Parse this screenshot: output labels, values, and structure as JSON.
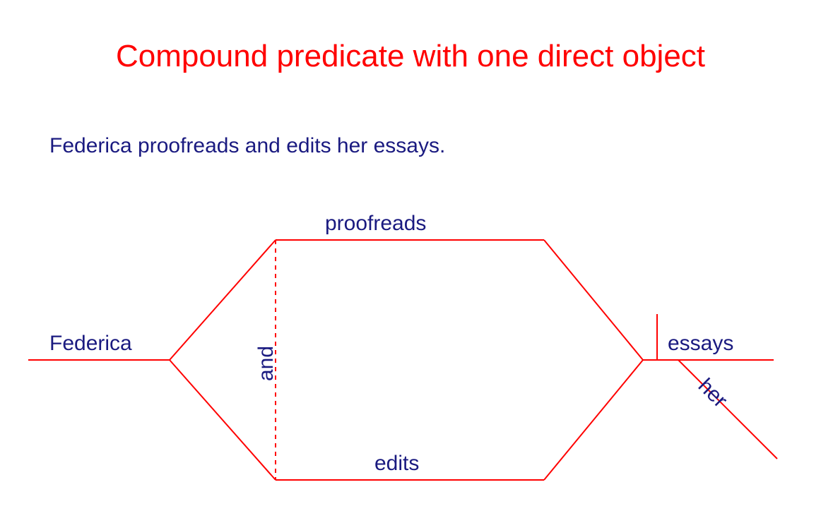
{
  "title": "Compound predicate with one direct object",
  "sentence": "Federica proofreads and edits her essays.",
  "labels": {
    "subject": "Federica",
    "verb1": "proofreads",
    "verb2": "edits",
    "conjunction": "and",
    "object": "essays",
    "modifier": "her"
  },
  "colors": {
    "title": "#ff0000",
    "text": "#1a1a80",
    "line": "#ff0000"
  }
}
